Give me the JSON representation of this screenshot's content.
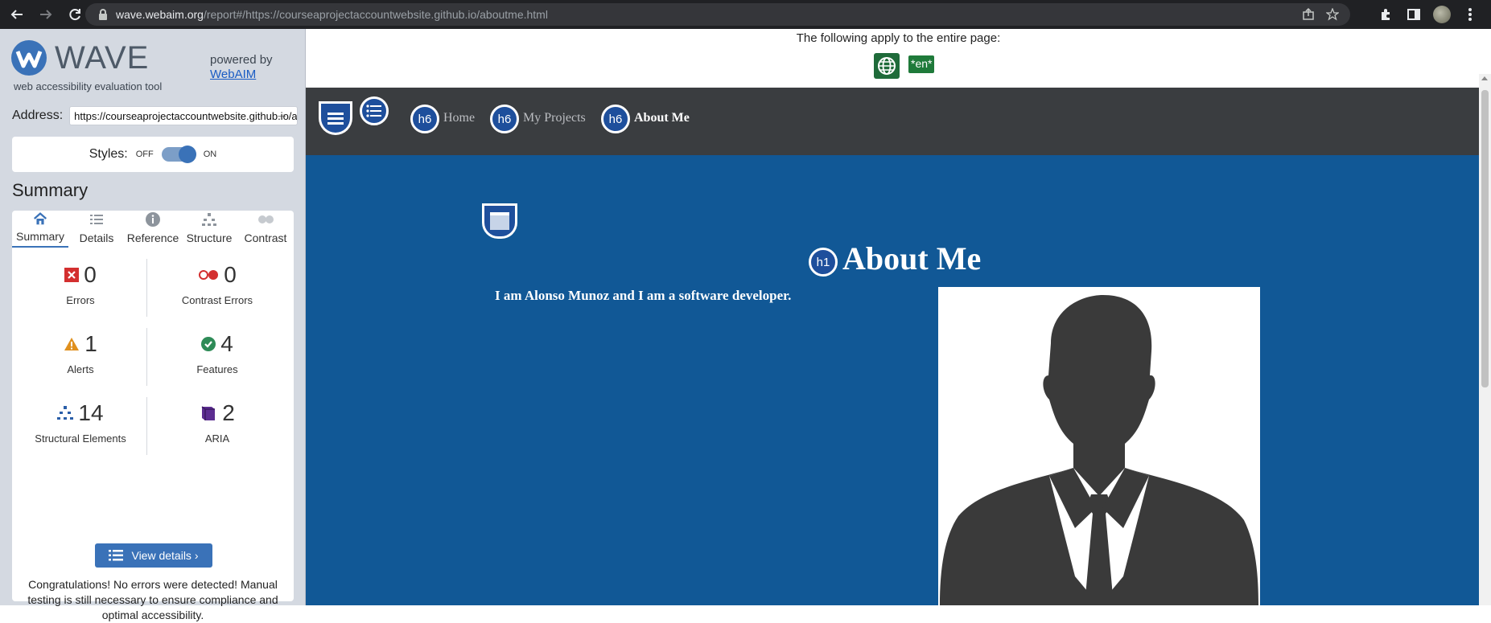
{
  "browser": {
    "back_icon": "arrow-left-icon",
    "forward_icon": "arrow-right-icon",
    "reload_icon": "reload-icon",
    "url_host": "wave.webaim.org",
    "url_path": "/report#/https://courseaprojectaccountwebsite.github.io/aboutme.html"
  },
  "wave": {
    "logo_text": "WAVE",
    "logo_sub": "web accessibility evaluation tool",
    "powered_by": "powered by",
    "webaim_link": "WebAIM",
    "address_label": "Address:",
    "address_value": "https://courseaprojectaccountwebsite.github.io/aboutme.html",
    "styles_label": "Styles:",
    "styles_off": "OFF",
    "styles_on": "ON",
    "styles_enabled": true,
    "summary_title": "Summary",
    "tabs": [
      {
        "label": "Summary",
        "icon": "home-icon",
        "active": true
      },
      {
        "label": "Details",
        "icon": "list-icon",
        "active": false
      },
      {
        "label": "Reference",
        "icon": "info-icon",
        "active": false
      },
      {
        "label": "Structure",
        "icon": "structure-icon",
        "active": false
      },
      {
        "label": "Contrast",
        "icon": "contrast-icon",
        "active": false
      }
    ],
    "stats": {
      "errors": {
        "value": "0",
        "label": "Errors"
      },
      "contrast_errors": {
        "value": "0",
        "label": "Contrast Errors"
      },
      "alerts": {
        "value": "1",
        "label": "Alerts"
      },
      "features": {
        "value": "4",
        "label": "Features"
      },
      "structural": {
        "value": "14",
        "label": "Structural Elements"
      },
      "aria": {
        "value": "2",
        "label": "ARIA"
      }
    },
    "view_details": "View details ›",
    "congrats": "Congratulations! No errors were detected! Manual testing is still necessary to ensure compliance and optimal accessibility."
  },
  "page": {
    "entire_page_text": "The following apply to the entire page:",
    "lang_badge": "*en*",
    "nav": {
      "home": "Home",
      "projects": "My Projects",
      "about": "About Me",
      "h6": "h6"
    },
    "h1_badge": "h1",
    "heading": "About Me",
    "intro": "I am Alonso Munoz and I am a software developer."
  },
  "colors": {
    "wave_blue": "#3a72b8",
    "site_header": "#3a3d40",
    "site_body": "#115896"
  }
}
